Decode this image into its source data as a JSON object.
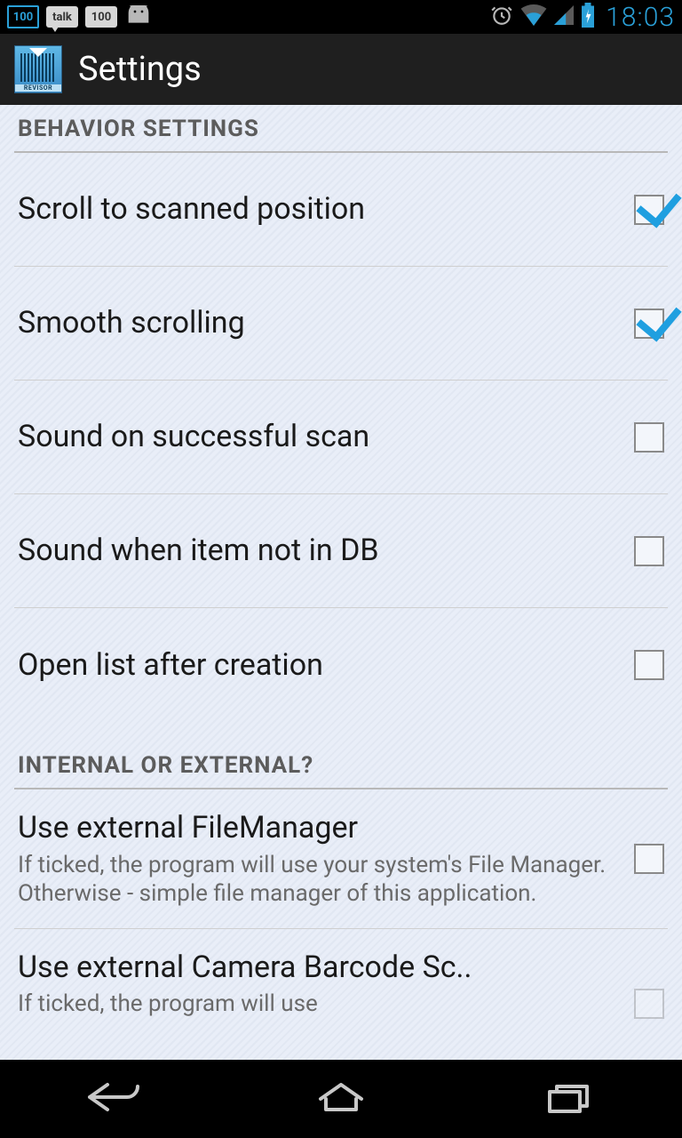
{
  "status": {
    "icon_100": "100",
    "icon_talk": "talk",
    "icon_100b": "100",
    "time": "18:03"
  },
  "actionbar": {
    "title": "Settings",
    "app_label": "REVISOR"
  },
  "sections": {
    "behavior": {
      "header": "BEHAVIOR SETTINGS",
      "items": [
        {
          "title": "Scroll to scanned position",
          "checked": true
        },
        {
          "title": "Smooth scrolling",
          "checked": true
        },
        {
          "title": "Sound on successful scan",
          "checked": false
        },
        {
          "title": "Sound when item not in DB",
          "checked": false
        },
        {
          "title": "Open list after creation",
          "checked": false
        }
      ]
    },
    "external": {
      "header": "INTERNAL OR EXTERNAL?",
      "items": [
        {
          "title": "Use external FileManager",
          "sub": "If ticked, the program will use your system's File Manager. Otherwise - simple file manager of this application.",
          "checked": false
        },
        {
          "title": "Use external Camera Barcode Sc..",
          "sub": "If ticked, the program will use",
          "checked": false
        }
      ]
    }
  }
}
